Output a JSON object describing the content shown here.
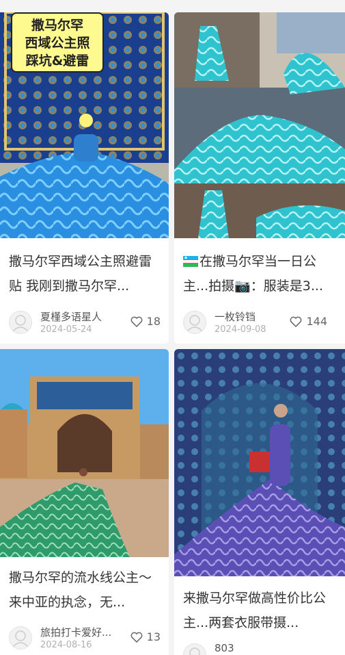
{
  "posts": [
    {
      "overlay_text": [
        "撒马尔罕",
        "西域公主照",
        "踩坑&避雷"
      ],
      "title": "撒马尔罕西域公主照避雷贴 我刚到撒马尔罕...",
      "author": "夏槿多语星人",
      "date": "2024-05-24",
      "likes": "18"
    },
    {
      "title_prefix_icon": "uzbekistan-flag-icon",
      "title": "在撒马尔罕当一日公主...拍摄📷：服装是3...",
      "author": "一枚铃铛",
      "date": "2024-09-08",
      "likes": "144"
    },
    {
      "title": "撒马尔罕的流水线公主～ 来中亚的执念，无...",
      "author": "旅拍打卡爱好...",
      "date": "2024-08-16",
      "likes": "13"
    },
    {
      "title": "来撒马尔罕做高性价比公主...两套衣服带摄...",
      "author": "803",
      "date": "",
      "likes": ""
    }
  ],
  "colors": {
    "accent_blue": "#1e7fd6",
    "teal": "#2bbfc9",
    "purple": "#5a4fb0"
  }
}
